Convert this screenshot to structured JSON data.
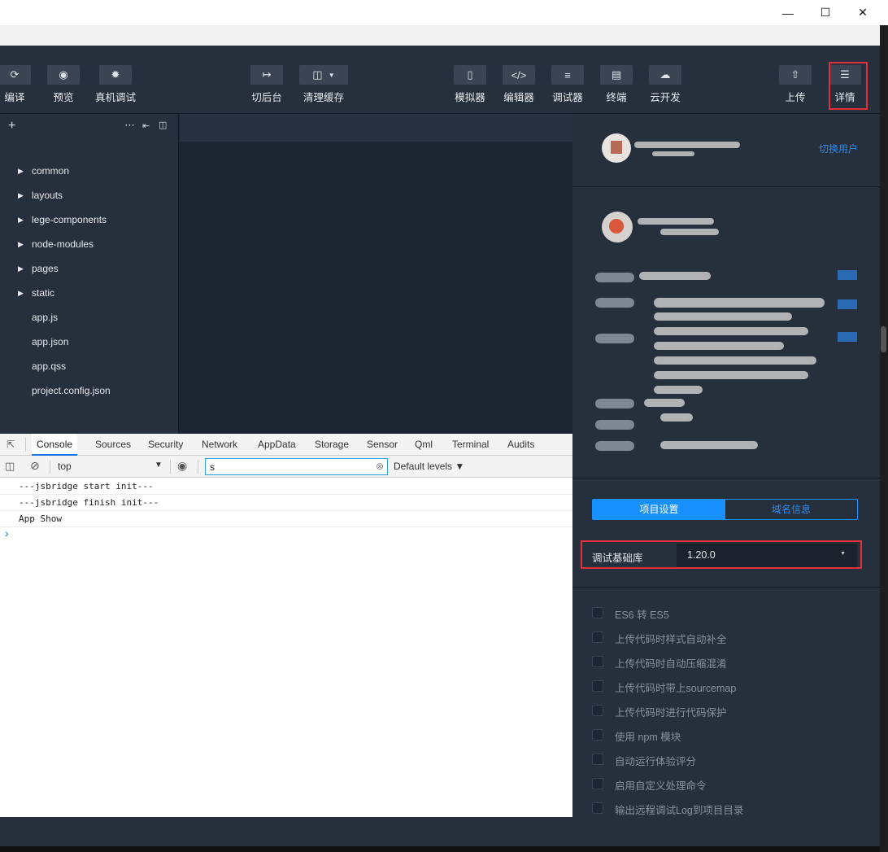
{
  "window": {
    "minimize_icon": "minimize-icon",
    "maximize_icon": "maximize-icon",
    "close_icon": "close-icon"
  },
  "toolbar": {
    "compile": "编译",
    "preview": "预览",
    "remote_debug": "真机调试",
    "switch_bg": "切后台",
    "clear_cache": "清理缓存",
    "simulator": "模拟器",
    "editor": "编辑器",
    "debugger": "调试器",
    "terminal": "终端",
    "cloud": "云开发",
    "upload": "上传",
    "detail": "详情"
  },
  "explorer": {
    "files": [
      {
        "name": "common",
        "folder": true
      },
      {
        "name": "layouts",
        "folder": true
      },
      {
        "name": "lege-components",
        "folder": true
      },
      {
        "name": "node-modules",
        "folder": true
      },
      {
        "name": "pages",
        "folder": true
      },
      {
        "name": "static",
        "folder": true
      },
      {
        "name": "app.js",
        "folder": false
      },
      {
        "name": "app.json",
        "folder": false
      },
      {
        "name": "app.qss",
        "folder": false
      },
      {
        "name": "project.config.json",
        "folder": false
      }
    ]
  },
  "devtools": {
    "tabs": [
      "Console",
      "Sources",
      "Security",
      "Network",
      "AppData",
      "Storage",
      "Sensor",
      "Qml",
      "Terminal",
      "Audits"
    ],
    "context": "top",
    "filter_value": "s",
    "levels": "Default levels",
    "logs": [
      "---jsbridge start init---",
      "---jsbridge finish init---",
      "App Show"
    ],
    "prompt": "›"
  },
  "panel": {
    "switch_user": "切换用户",
    "tab_project": "项目设置",
    "tab_domain": "域名信息",
    "lib_label": "调试基础库",
    "lib_value": "1.20.0",
    "options": [
      "ES6 转 ES5",
      "上传代码时样式自动补全",
      "上传代码时自动压缩混淆",
      "上传代码时带上sourcemap",
      "上传代码时进行代码保护",
      "使用 npm 模块",
      "自动运行体验评分",
      "启用自定义处理命令",
      "输出远程调试Log到项目目录"
    ]
  },
  "colors": {
    "accent": "#1890ff",
    "highlight": "#e0303a",
    "link": "#2d8cf0"
  }
}
